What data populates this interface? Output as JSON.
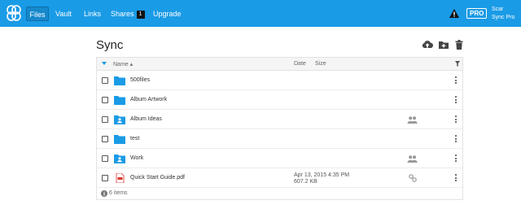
{
  "nav": {
    "items": [
      {
        "label": "Files"
      },
      {
        "label": "Vault"
      },
      {
        "label": "Links"
      },
      {
        "label": "Shares",
        "badge": "1"
      },
      {
        "label": "Upgrade"
      }
    ]
  },
  "user": {
    "plan_badge": "PRO",
    "name": "Scar",
    "plan": "Sync Pro"
  },
  "page": {
    "title": "Sync"
  },
  "table": {
    "columns": {
      "name": "Name ▴",
      "date": "Date",
      "size": "Size"
    },
    "rows": [
      {
        "name": "500files",
        "icon": "folder-icon",
        "date": "",
        "size": "",
        "shared": false,
        "linked": false
      },
      {
        "name": "Album Artwork",
        "icon": "folder-icon",
        "date": "",
        "size": "",
        "shared": false,
        "linked": false
      },
      {
        "name": "Album Ideas",
        "icon": "shared-folder-icon",
        "date": "",
        "size": "",
        "shared": true,
        "linked": false
      },
      {
        "name": "test",
        "icon": "folder-icon",
        "date": "",
        "size": "",
        "shared": false,
        "linked": false
      },
      {
        "name": "Work",
        "icon": "shared-folder-icon",
        "date": "",
        "size": "",
        "shared": true,
        "linked": false
      },
      {
        "name": "Quick Start Guide.pdf",
        "icon": "pdf-file-icon",
        "date": "Apr 13, 2015 4:35 PM",
        "size": "607.2 KB",
        "shared": false,
        "linked": true
      }
    ],
    "footer": "6 items"
  },
  "colors": {
    "brand": "#1a9be6",
    "folder": "#1a9be6",
    "pdf": "#d9342b"
  }
}
